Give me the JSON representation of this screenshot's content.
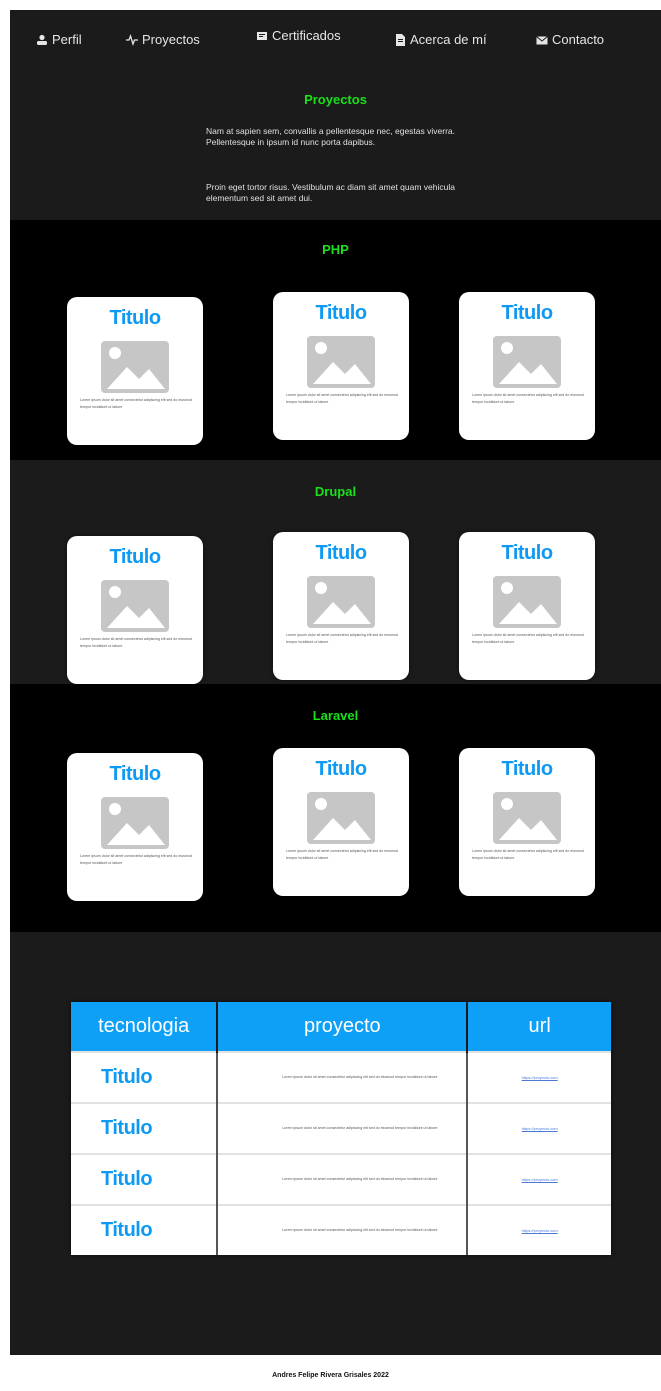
{
  "nav": {
    "items": [
      {
        "label": "Perfil",
        "icon": "user-icon"
      },
      {
        "label": "Proyectos",
        "icon": "pulse-icon"
      },
      {
        "label": "Certificados",
        "icon": "certificate-icon"
      },
      {
        "label": "Acerca de mí",
        "icon": "document-icon"
      },
      {
        "label": "Contacto",
        "icon": "mail-icon"
      }
    ]
  },
  "intro": {
    "title": "Proyectos",
    "p1": "Nam at sapien sem, convallis a pellentesque nec, egestas viverra. Pellentesque in ipsum id nunc porta dapibus.",
    "p2": "Proin eget tortor risus. Vestibulum ac diam sit amet quam vehicula elementum sed sit amet dui."
  },
  "sections": [
    {
      "title": "PHP",
      "cards": [
        {
          "title": "Titulo",
          "text": "Lorem ipsum dolor sit amet consectetur adipiscing elit sed do eiusmod tempor incididunt ut labore"
        },
        {
          "title": "Titulo",
          "text": "Lorem ipsum dolor sit amet consectetur adipiscing elit sed do eiusmod tempor incididunt ut labore"
        },
        {
          "title": "Titulo",
          "text": "Lorem ipsum dolor sit amet consectetur adipiscing elit sed do eiusmod tempor incididunt ut labore"
        }
      ]
    },
    {
      "title": "Drupal",
      "cards": [
        {
          "title": "Titulo",
          "text": "Lorem ipsum dolor sit amet consectetur adipiscing elit sed do eiusmod tempor incididunt ut labore"
        },
        {
          "title": "Titulo",
          "text": "Lorem ipsum dolor sit amet consectetur adipiscing elit sed do eiusmod tempor incididunt ut labore"
        },
        {
          "title": "Titulo",
          "text": "Lorem ipsum dolor sit amet consectetur adipiscing elit sed do eiusmod tempor incididunt ut labore"
        }
      ]
    },
    {
      "title": "Laravel",
      "cards": [
        {
          "title": "Titulo",
          "text": "Lorem ipsum dolor sit amet consectetur adipiscing elit sed do eiusmod tempor incididunt ut labore"
        },
        {
          "title": "Titulo",
          "text": "Lorem ipsum dolor sit amet consectetur adipiscing elit sed do eiusmod tempor incididunt ut labore"
        },
        {
          "title": "Titulo",
          "text": "Lorem ipsum dolor sit amet consectetur adipiscing elit sed do eiusmod tempor incididunt ut labore"
        }
      ]
    }
  ],
  "table": {
    "headers": [
      "tecnologia",
      "proyecto",
      "url"
    ],
    "rows": [
      {
        "tech": "Titulo",
        "desc": "Lorem ipsum dolor sit amet consectetur adipiscing elit sed do eiusmod tempor incididunt ut labore",
        "url": "https://proyecto.com"
      },
      {
        "tech": "Titulo",
        "desc": "Lorem ipsum dolor sit amet consectetur adipiscing elit sed do eiusmod tempor incididunt ut labore",
        "url": "https://proyecto.com"
      },
      {
        "tech": "Titulo",
        "desc": "Lorem ipsum dolor sit amet consectetur adipiscing elit sed do eiusmod tempor incididunt ut labore",
        "url": "https://proyecto.com"
      },
      {
        "tech": "Titulo",
        "desc": "Lorem ipsum dolor sit amet consectetur adipiscing elit sed do eiusmod tempor incididunt ut labore",
        "url": "https://proyecto.com"
      }
    ]
  },
  "footer": "Andres Felipe Rivera Grisales 2022",
  "colors": {
    "accent_green": "#19e019",
    "accent_blue": "#0e9af2",
    "page_bg": "#1b1b1b",
    "section_bg": "#000000"
  }
}
